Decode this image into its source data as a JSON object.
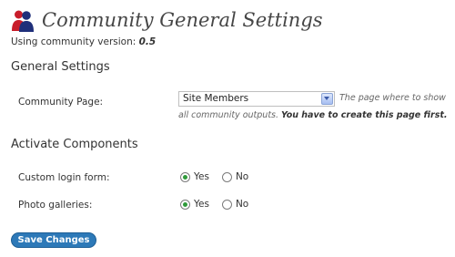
{
  "header": {
    "title": "Community General Settings",
    "version_label": "Using community version:",
    "version_value": "0.5"
  },
  "general": {
    "heading": "General Settings",
    "community_page": {
      "label": "Community Page:",
      "selected": "Site Members",
      "description_prefix": "The page where to show",
      "description_continued": "all community outputs.",
      "description_bold": "You have to create this page first."
    }
  },
  "components": {
    "heading": "Activate Components",
    "custom_login": {
      "label": "Custom login form:",
      "yes": "Yes",
      "no": "No",
      "selected": "Yes"
    },
    "photo_galleries": {
      "label": "Photo galleries:",
      "yes": "Yes",
      "no": "No",
      "selected": "Yes"
    }
  },
  "actions": {
    "save_label": "Save Changes"
  },
  "colors": {
    "accent": "#2d79b8",
    "radio_checked": "#2f9a3a",
    "title": "#464646"
  },
  "icons": {
    "header": "users-icon",
    "dropdown": "chevron-down-icon"
  }
}
